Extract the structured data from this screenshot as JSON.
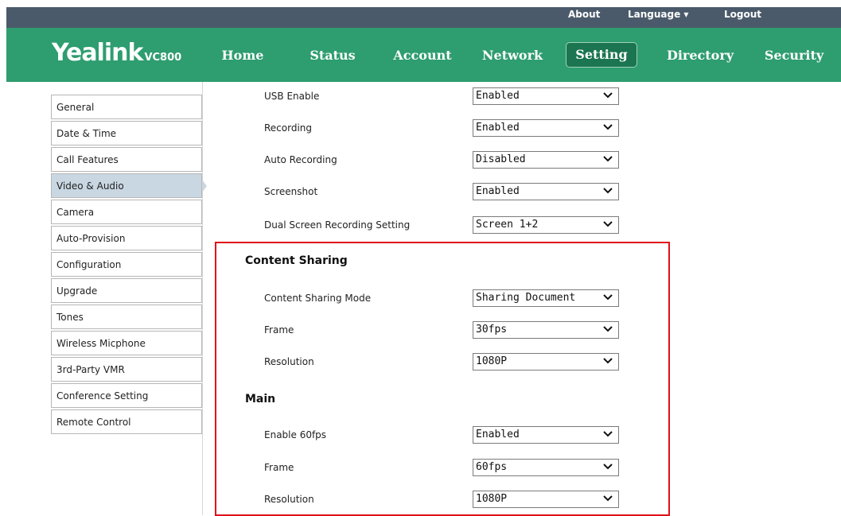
{
  "topbar": {
    "about": "About",
    "language": "Language ▾",
    "logout": "Logout"
  },
  "logo": {
    "brand": "Yealink",
    "model": "VC800"
  },
  "nav": {
    "items": [
      "Home",
      "Status",
      "Account",
      "Network",
      "Setting",
      "Directory",
      "Security"
    ],
    "active": "Setting"
  },
  "sidebar": {
    "items": [
      "General",
      "Date & Time",
      "Call Features",
      "Video & Audio",
      "Camera",
      "Auto-Provision",
      "Configuration",
      "Upgrade",
      "Tones",
      "Wireless Micphone",
      "3rd-Party VMR",
      "Conference Setting",
      "Remote Control"
    ],
    "active": "Video & Audio"
  },
  "form": {
    "usb_enable": {
      "label": "USB Enable",
      "value": "Enabled"
    },
    "recording": {
      "label": "Recording",
      "value": "Enabled"
    },
    "auto_recording": {
      "label": "Auto Recording",
      "value": "Disabled"
    },
    "screenshot": {
      "label": "Screenshot",
      "value": "Enabled"
    },
    "dual_screen": {
      "label": "Dual Screen Recording Setting",
      "value": "Screen 1+2"
    },
    "content_sharing": {
      "title": "Content Sharing",
      "mode": {
        "label": "Content Sharing Mode",
        "value": "Sharing Document"
      },
      "frame": {
        "label": "Frame",
        "value": "30fps"
      },
      "resolution": {
        "label": "Resolution",
        "value": "1080P"
      }
    },
    "main": {
      "title": "Main",
      "enable60": {
        "label": "Enable 60fps",
        "value": "Enabled"
      },
      "frame": {
        "label": "Frame",
        "value": "60fps"
      },
      "resolution": {
        "label": "Resolution",
        "value": "1080P"
      }
    }
  },
  "colors": {
    "nav_bg": "#2e9d6f",
    "nav_active": "#1b7550",
    "topbar_bg": "#4a5a6a",
    "highlight_box": "#e0101a"
  },
  "icons": {
    "select_arrow": "chevron-down-icon"
  }
}
